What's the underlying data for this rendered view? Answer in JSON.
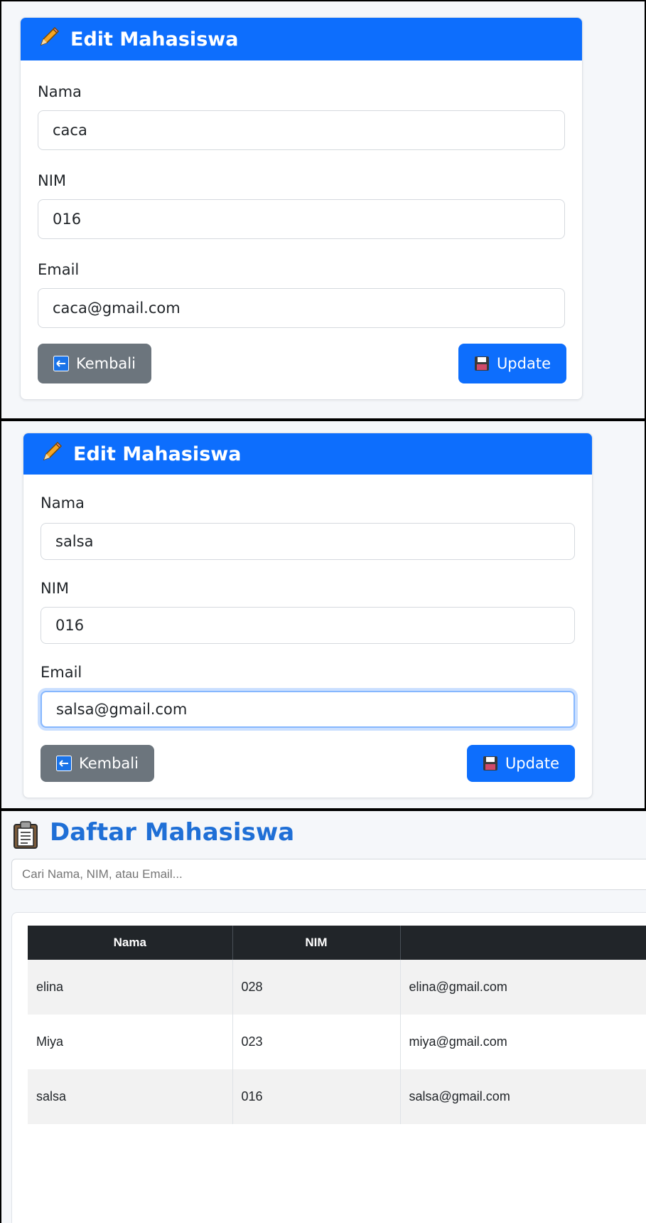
{
  "form1": {
    "title": "Edit Mahasiswa",
    "nama_label": "Nama",
    "nama_value": "caca",
    "nim_label": "NIM",
    "nim_value": "016",
    "email_label": "Email",
    "email_value": "caca@gmail.com",
    "back_label": "Kembali",
    "update_label": "Update"
  },
  "form2": {
    "title": "Edit Mahasiswa",
    "nama_label": "Nama",
    "nama_value": "salsa",
    "nim_label": "NIM",
    "nim_value": "016",
    "email_label": "Email",
    "email_value": "salsa@gmail.com",
    "back_label": "Kembali",
    "update_label": "Update"
  },
  "list": {
    "title": "Daftar Mahasiswa",
    "search_placeholder": "Cari Nama, NIM, atau Email...",
    "columns": [
      "Nama",
      "NIM",
      ""
    ],
    "rows": [
      {
        "nama": "elina",
        "nim": "028",
        "email": "elina@gmail.com"
      },
      {
        "nama": "Miya",
        "nim": "023",
        "email": "miya@gmail.com"
      },
      {
        "nama": "salsa",
        "nim": "016",
        "email": "salsa@gmail.com"
      }
    ]
  },
  "icons": {
    "header": "pencil-icon",
    "back": "arrow-left-icon",
    "update": "floppy-disk-icon",
    "list": "clipboard-icon"
  },
  "colors": {
    "primary": "#0d6efd",
    "secondary": "#6c757d",
    "table_header": "#212529",
    "title_blue": "#1f6fd6"
  }
}
